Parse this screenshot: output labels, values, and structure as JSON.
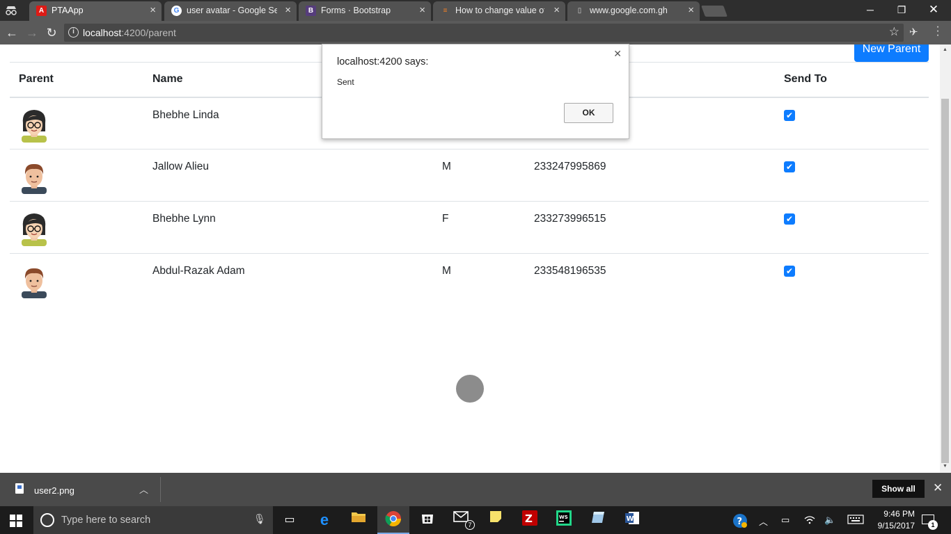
{
  "browser": {
    "tabs": [
      {
        "label": "PTAApp",
        "icon": "angular-icon",
        "color": "#dd1b16",
        "glyph": "A"
      },
      {
        "label": "user avatar - Google Sea",
        "icon": "google-icon",
        "color": "#ffffff",
        "glyph": "G"
      },
      {
        "label": "Forms · Bootstrap",
        "icon": "bootstrap-icon",
        "color": "#563d7c",
        "glyph": "B"
      },
      {
        "label": "How to change value of",
        "icon": "stackoverflow-icon",
        "color": "#f48024",
        "glyph": "≡"
      },
      {
        "label": "www.google.com.gh",
        "icon": "page-icon",
        "color": "#5a5a5a",
        "glyph": "▯"
      }
    ],
    "url_host": "localhost",
    "url_path": ":4200/parent"
  },
  "page": {
    "new_parent_label": "New Parent",
    "columns": [
      "Parent",
      "Name",
      "Send To"
    ],
    "rows": [
      {
        "name": "Bhebhe Linda",
        "gender": "",
        "phone": "",
        "avatar": "female",
        "send": true
      },
      {
        "name": "Jallow Alieu",
        "gender": "M",
        "phone": "233247995869",
        "avatar": "male",
        "send": true
      },
      {
        "name": "Bhebhe Lynn",
        "gender": "F",
        "phone": "233273996515",
        "avatar": "female",
        "send": true
      },
      {
        "name": "Abdul-Razak Adam",
        "gender": "M",
        "phone": "233548196535",
        "avatar": "male",
        "send": true
      }
    ]
  },
  "alert": {
    "title": "localhost:4200 says:",
    "message": "Sent",
    "ok_label": "OK"
  },
  "downloads": {
    "file_name": "user2.png",
    "show_all_label": "Show all"
  },
  "taskbar": {
    "search_placeholder": "Type here to search",
    "mail_badge": "7",
    "time": "9:46 PM",
    "date": "9/15/2017",
    "notifications": "1"
  }
}
